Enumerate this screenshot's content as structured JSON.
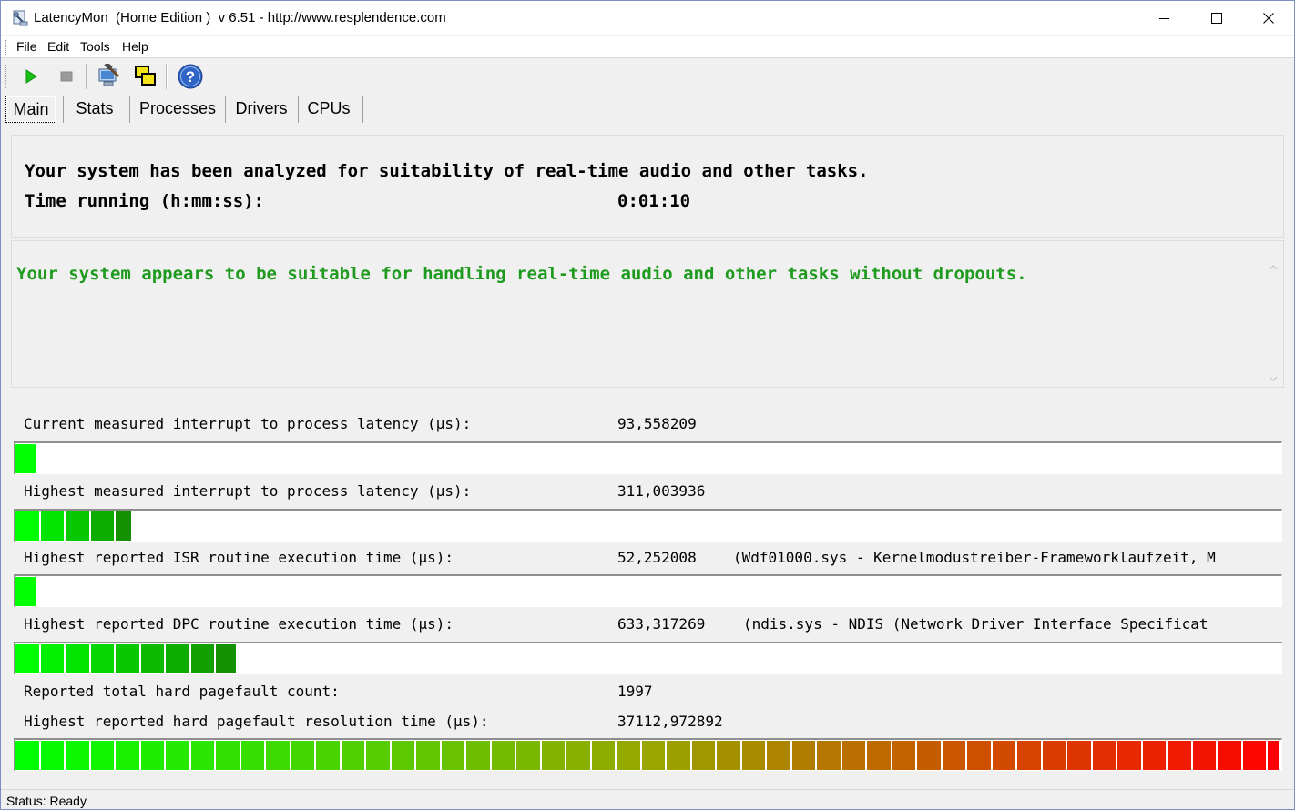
{
  "window": {
    "title": "LatencyMon  (Home Edition )  v 6.51 - http://www.resplendence.com"
  },
  "menu": {
    "file": "File",
    "edit": "Edit",
    "tools": "Tools",
    "help": "Help"
  },
  "toolbar": {
    "icons": [
      "play-icon",
      "stop-icon",
      "computer-tools-icon",
      "windows-icon",
      "help-icon"
    ]
  },
  "tabs": {
    "main": "Main",
    "stats": "Stats",
    "processes": "Processes",
    "drivers": "Drivers",
    "cpus": "CPUs",
    "active": "Main"
  },
  "summary": {
    "analyzed_text": "Your system has been analyzed for suitability of real-time audio and other tasks.",
    "time_label": "Time running (h:mm:ss):",
    "time_value": "0:01:10"
  },
  "verdict": {
    "message": "Your system appears to be suitable for handling real-time audio and other tasks without dropouts."
  },
  "metrics": {
    "current_latency": {
      "label": "Current measured interrupt to process latency (µs):",
      "value": "93,558209",
      "level": 0.017
    },
    "highest_latency": {
      "label": "Highest measured interrupt to process latency (µs):",
      "value": "311,003936",
      "level": 0.093
    },
    "isr": {
      "label": "Highest reported ISR routine execution time (µs):",
      "value": "52,252008",
      "driver": "(Wdf01000.sys - Kernelmodustreiber-Frameworklaufzeit, M",
      "level": 0.018
    },
    "dpc": {
      "label": "Highest reported DPC routine execution time (µs):",
      "value": "633,317269",
      "driver": "(ndis.sys - NDIS (Network Driver Interface Specificat",
      "level": 0.176
    },
    "pagefault_count": {
      "label": "Reported total hard pagefault count:",
      "value": "1997"
    },
    "pagefault_time": {
      "label": "Highest reported hard pagefault resolution time (µs):",
      "value": "37112,972892",
      "level": 1.0
    }
  },
  "status": {
    "text": "Status: Ready"
  },
  "colors": {
    "message_green": "#1e9a1e",
    "bar_green": "#00ff00",
    "bar_red": "#ff0000"
  }
}
